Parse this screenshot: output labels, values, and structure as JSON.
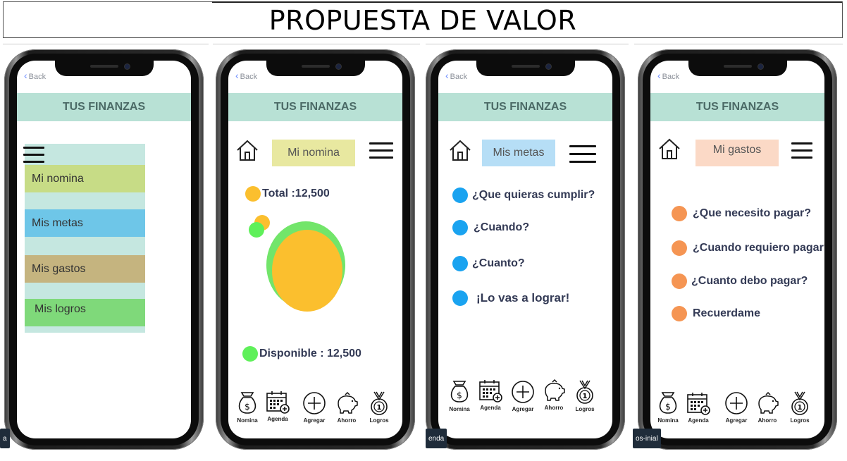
{
  "page_title": "PROPUESTA DE VALOR",
  "app": {
    "back_label": "Back",
    "header_title": "TUS FINANZAS"
  },
  "screen1": {
    "menu": [
      {
        "label": "Mi nomina",
        "color": "#c7dc86"
      },
      {
        "label": "Mis metas",
        "color": "#6ec6e8"
      },
      {
        "label": "Mis  gastos",
        "color": "#c5b47f"
      },
      {
        "label": "Mis logros",
        "color": "#7fd97a"
      }
    ]
  },
  "screen2": {
    "section": "Mi nomina",
    "section_color": "#e8e8a0",
    "total_label": "Total :12,500",
    "available_label": "Disponible : 12,500",
    "accent_yellow": "#fbbf2e",
    "accent_green": "#5ff05a"
  },
  "screen3": {
    "section": "Mis metas",
    "section_color": "#b6def6",
    "dot_color": "#1aa3f0",
    "items": [
      "¿Que quieras cumplir?",
      "¿Cuando?",
      "¿Cuanto?",
      "¡Lo vas a lograr!"
    ]
  },
  "screen4": {
    "section": "Mi gastos",
    "section_color": "#fbd9c6",
    "dot_color": "#f59553",
    "items": [
      "¿Que necesito pagar?",
      "¿Cuando requiero pagar?",
      "¿Cuanto debo pagar?",
      "Recuerdame"
    ]
  },
  "tabbar": {
    "items": [
      {
        "label": "Nomina",
        "icon": "money-bag-icon"
      },
      {
        "label": "Agenda",
        "icon": "calendar-add-icon"
      },
      {
        "label": "Agregar",
        "icon": "plus-circle-icon"
      },
      {
        "label": "Ahorro",
        "icon": "piggy-bank-icon"
      },
      {
        "label": "Logros",
        "icon": "medal-icon"
      }
    ]
  },
  "edge_tags": [
    "a",
    "enda",
    "os-inial"
  ]
}
